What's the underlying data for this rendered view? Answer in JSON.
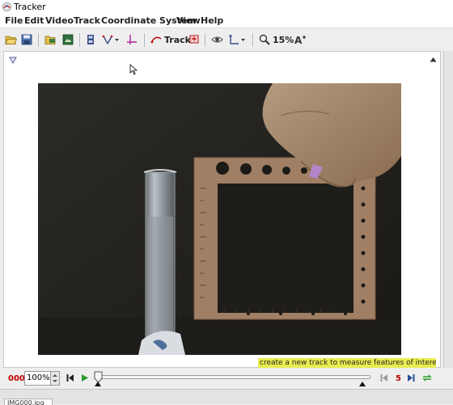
{
  "window": {
    "title": "Tracker"
  },
  "menubar": {
    "items": [
      "File",
      "Edit",
      "Video",
      "Track",
      "Coordinate System",
      "View",
      "Help"
    ]
  },
  "toolbar": {
    "track_label": "Track",
    "zoom_label": "15%",
    "icons": [
      "open-folder-icon",
      "save-icon",
      "open-video-icon",
      "export-image-icon",
      "clip-settings-icon",
      "calibration-points-icon",
      "axes-icon",
      "new-track-icon",
      "track-control-icon",
      "visibility-eye-icon",
      "coordinate-axes-icon",
      "zoom-magnifier-icon",
      "font-size-icon"
    ]
  },
  "video": {
    "description_text": ""
  },
  "status": {
    "message": "create a new track to measure features of interest"
  },
  "player": {
    "frame_number": "000",
    "zoom_value": "100%",
    "step_size": "5"
  },
  "bottom": {
    "file_tab": "IMG000.jpg"
  },
  "colors": {
    "accent_red": "#c00000",
    "status_yellow": "#e8ec50",
    "panel_bg": "#eeeeee"
  }
}
